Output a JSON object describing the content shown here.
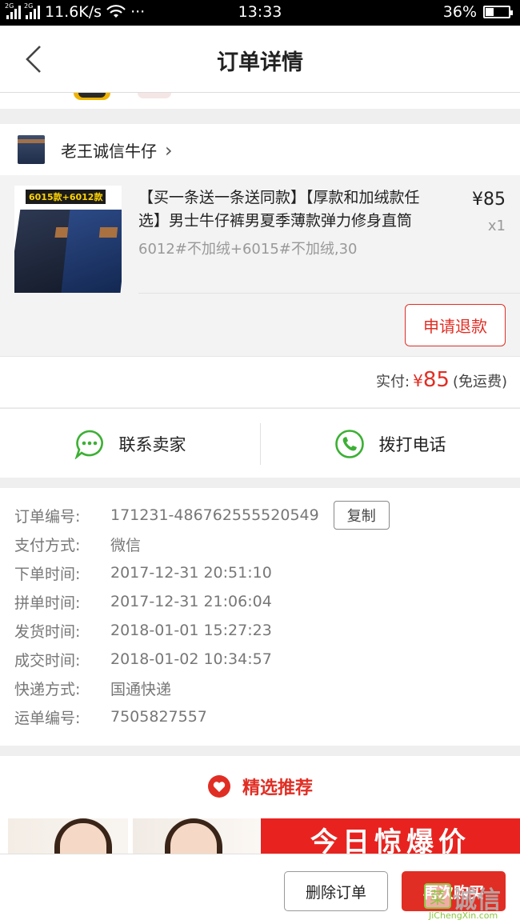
{
  "status_bar": {
    "network_left": "2G",
    "network_right": "2G",
    "speed": "11.6K/s",
    "more": "···",
    "time": "13:33",
    "battery_text": "36%",
    "battery_level": 0.36
  },
  "nav": {
    "title": "订单详情"
  },
  "shop": {
    "name": "老王诚信牛仔",
    "chevron": "›"
  },
  "product": {
    "image_tag": "6015款+6012款",
    "title": "【买一条送一条送同款】【厚款和加绒款任选】男士牛仔裤男夏季薄款弹力修身直筒",
    "spec": "6012#不加绒+6015#不加绒,30",
    "price": "¥85",
    "qty": "x1",
    "refund_label": "申请退款"
  },
  "payment": {
    "paid_label": "实付:",
    "currency": "¥",
    "amount": "85",
    "shipping_note": "(免运费)"
  },
  "contact": {
    "seller_label": "联系卖家",
    "phone_label": "拨打电话"
  },
  "order_info": {
    "copy_label": "复制",
    "rows": [
      {
        "label": "订单编号:",
        "value": "171231-486762555520549"
      },
      {
        "label": "支付方式:",
        "value": "微信"
      },
      {
        "label": "下单时间:",
        "value": "2017-12-31 20:51:10"
      },
      {
        "label": "拼单时间:",
        "value": "2017-12-31 21:06:04"
      },
      {
        "label": "发货时间:",
        "value": "2018-01-01 15:27:23"
      },
      {
        "label": "成交时间:",
        "value": "2018-01-02 10:34:57"
      },
      {
        "label": "快递方式:",
        "value": "国通快递"
      },
      {
        "label": "运单编号:",
        "value": "7505827557"
      }
    ]
  },
  "recommend": {
    "title": "精选推荐",
    "banner_text": "今日惊爆价"
  },
  "bottom": {
    "delete_label": "删除订单",
    "rebuy_label": "再次购买"
  },
  "watermark": {
    "icon": "菜",
    "text": "诚信",
    "sub": "JiChengXin.com"
  },
  "colors": {
    "accent_red": "#e02e24",
    "wechat_green": "#3cb034"
  }
}
